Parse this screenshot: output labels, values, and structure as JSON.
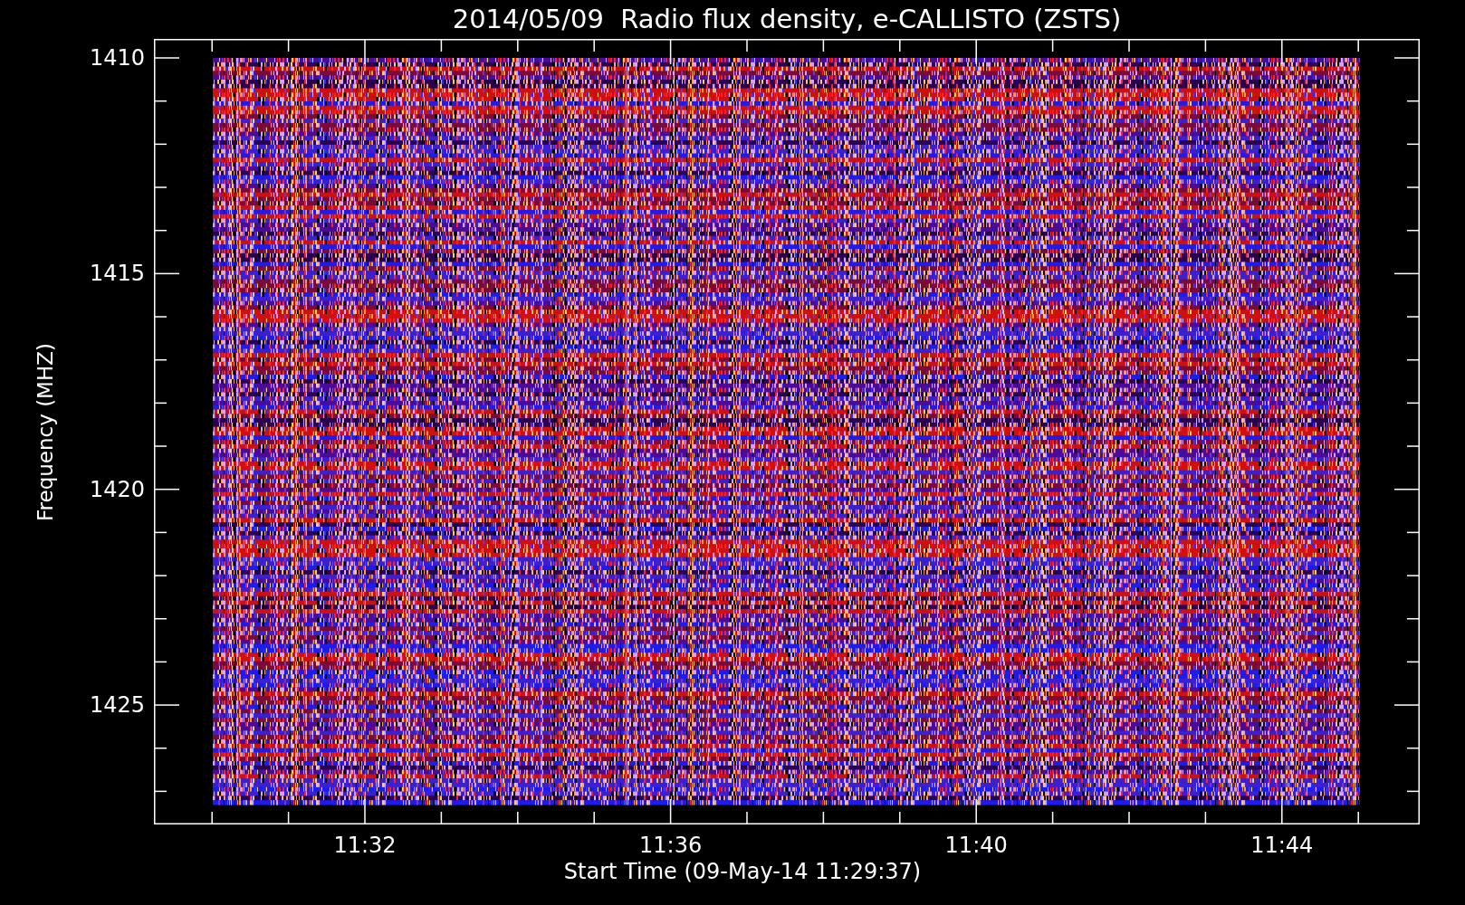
{
  "title": "2014/05/09  Radio flux density, e-CALLISTO (ZSTS)",
  "y_axis": {
    "label": "Frequency (MHZ)",
    "ticks": [
      "1410",
      "1415",
      "1420",
      "1425"
    ]
  },
  "x_axis": {
    "label": "Start Time (09-May-14 11:29:37)",
    "ticks": [
      "11:32",
      "11:36",
      "11:40",
      "11:44"
    ]
  }
}
